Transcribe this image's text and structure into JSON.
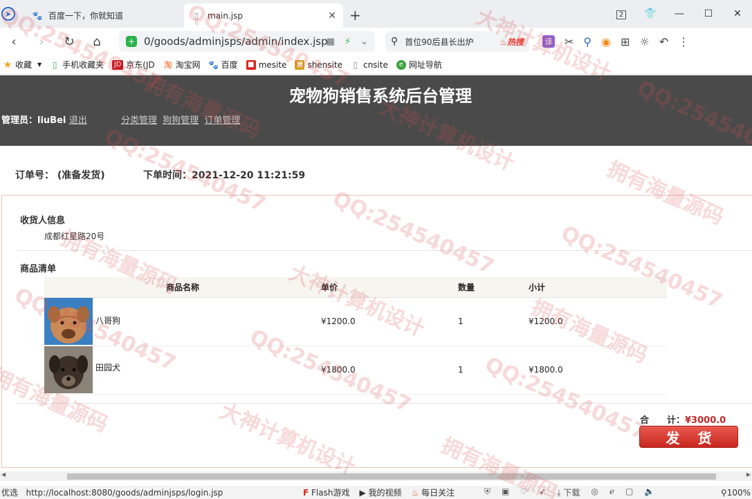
{
  "browser": {
    "tabs": [
      {
        "label": "百度一下，你就知道",
        "active": false
      },
      {
        "label": "main.jsp",
        "active": true
      }
    ],
    "tab_count": "2",
    "address": "0/goods/adminjsps/admin/index.jsp",
    "search_text": "首位90后县长出炉",
    "search_badge": "热搜",
    "bookmarks": [
      {
        "label": "收藏",
        "icon": "star-icon"
      },
      {
        "label": "手机收藏夹",
        "icon": "phone-icon"
      },
      {
        "label": "京东(JD",
        "icon": "jd-icon"
      },
      {
        "label": "淘宝网",
        "icon": "taobao-icon"
      },
      {
        "label": "百度",
        "icon": "baidu-icon"
      },
      {
        "label": "mesite",
        "icon": "mesite-icon"
      },
      {
        "label": "shensite",
        "icon": "shensite-icon"
      },
      {
        "label": "cnsite",
        "icon": "page-icon"
      },
      {
        "label": "网址导航",
        "icon": "nav-icon"
      }
    ]
  },
  "header": {
    "title": "宠物狗销售系统后台管理",
    "admin_label": "管理员：liuBei",
    "logout": "退出",
    "menu": [
      "分类管理",
      "狗狗管理",
      "订单管理"
    ]
  },
  "order": {
    "number_label": "订单号：",
    "status": "(准备发货)",
    "time_label": "下单时间：2021-12-20 11:21:59",
    "receiver_title": "收货人信息",
    "receiver_address": "成都红星路20号",
    "items_title": "商品清单",
    "columns": [
      "商品名称",
      "单价",
      "数量",
      "小计"
    ],
    "items": [
      {
        "name": "八哥狗",
        "price": "¥1200.0",
        "qty": "1",
        "subtotal": "¥1200.0"
      },
      {
        "name": "田园犬",
        "price": "¥1800.0",
        "qty": "1",
        "subtotal": "¥1800.0"
      }
    ],
    "total_label": "合　　计：",
    "total_value": "¥3000.0",
    "ship_button": "发货"
  },
  "status_bar": {
    "left": "优选",
    "url": "http://localhost:8080/goods/adminjsps/login.jsp",
    "items": [
      "Flash游戏",
      "我的视频",
      "每日关注"
    ],
    "download": "下载",
    "zoom": "100%"
  },
  "watermarks": [
    "QQ:254540457",
    "大神计算机设计",
    "拥有海量源码"
  ],
  "colors": {
    "header_bg": "#4a4a4a",
    "accent_red": "#c8271f",
    "box_border": "#e8c7b6"
  }
}
